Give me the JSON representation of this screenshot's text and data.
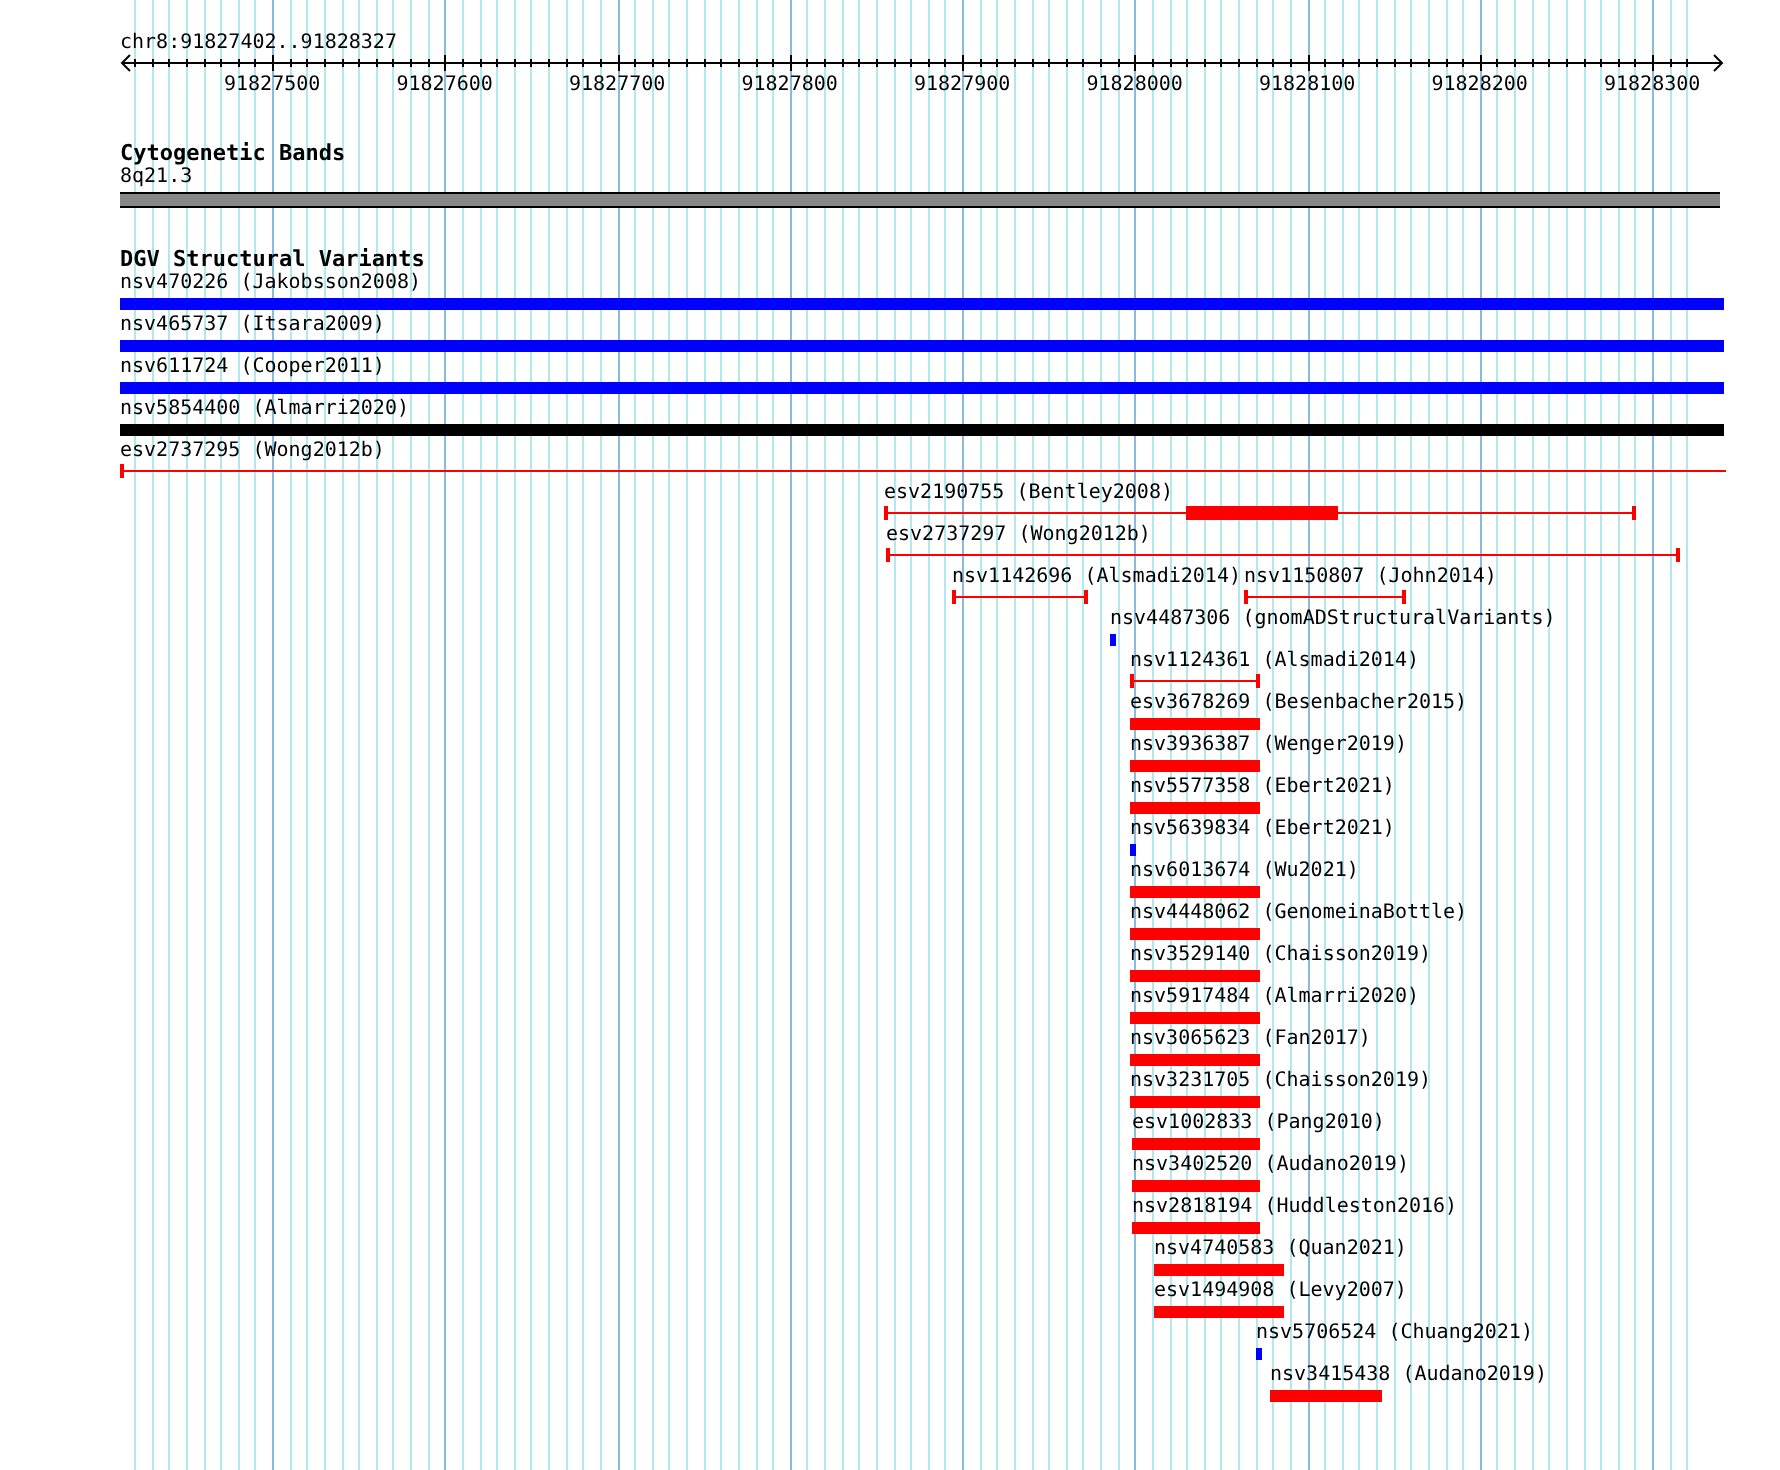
{
  "ruler": {
    "location": "chr8:91827402..91828327",
    "tick_labels": [
      "91827500",
      "91827600",
      "91827700",
      "91827800",
      "91827900",
      "91828000",
      "91828100",
      "91828200",
      "91828300"
    ]
  },
  "cytogenetic_bands": {
    "title": "Cytogenetic Bands",
    "band": "8q21.3"
  },
  "dgv_structural_variants": {
    "title": "DGV Structural Variants",
    "rows": [
      {
        "features": [
          {
            "label": "nsv470226 (Jakobsson2008)",
            "kind": "bar",
            "color": "#0000ff"
          }
        ]
      },
      {
        "features": [
          {
            "label": "nsv465737 (Itsara2009)",
            "kind": "bar",
            "color": "#0000ff"
          }
        ]
      },
      {
        "features": [
          {
            "label": "nsv611724 (Cooper2011)",
            "kind": "bar",
            "color": "#0000ff"
          }
        ]
      },
      {
        "features": [
          {
            "label": "nsv5854400 (Almarri2020)",
            "kind": "bar",
            "color": "#000000"
          }
        ]
      },
      {
        "features": [
          {
            "label": "esv2737295 (Wong2012b)",
            "kind": "range",
            "color": "#ff0000"
          }
        ]
      },
      {
        "features": [
          {
            "label": "esv2190755 (Bentley2008)",
            "kind": "range",
            "color": "#ff0000"
          }
        ]
      },
      {
        "features": [
          {
            "label": "esv2737297 (Wong2012b)",
            "kind": "range",
            "color": "#ff0000"
          }
        ]
      },
      {
        "features": [
          {
            "label": "nsv1142696 (Alsmadi2014)",
            "kind": "range",
            "color": "#ff0000"
          },
          {
            "label": "nsv1150807 (John2014)",
            "kind": "range",
            "color": "#ff0000"
          }
        ]
      },
      {
        "features": [
          {
            "label": "nsv4487306 (gnomADStructuralVariants)",
            "kind": "point",
            "color": "#0000ff"
          }
        ]
      },
      {
        "features": [
          {
            "label": "nsv1124361 (Alsmadi2014)",
            "kind": "range",
            "color": "#ff0000"
          }
        ]
      },
      {
        "features": [
          {
            "label": "esv3678269 (Besenbacher2015)",
            "kind": "bar",
            "color": "#ff0000"
          }
        ]
      },
      {
        "features": [
          {
            "label": "nsv3936387 (Wenger2019)",
            "kind": "bar",
            "color": "#ff0000"
          }
        ]
      },
      {
        "features": [
          {
            "label": "nsv5577358 (Ebert2021)",
            "kind": "bar",
            "color": "#ff0000"
          }
        ]
      },
      {
        "features": [
          {
            "label": "nsv5639834 (Ebert2021)",
            "kind": "point",
            "color": "#0000ff"
          }
        ]
      },
      {
        "features": [
          {
            "label": "nsv6013674 (Wu2021)",
            "kind": "bar",
            "color": "#ff0000"
          }
        ]
      },
      {
        "features": [
          {
            "label": "nsv4448062 (GenomeinaBottle)",
            "kind": "bar",
            "color": "#ff0000"
          }
        ]
      },
      {
        "features": [
          {
            "label": "nsv3529140 (Chaisson2019)",
            "kind": "bar",
            "color": "#ff0000"
          }
        ]
      },
      {
        "features": [
          {
            "label": "nsv5917484 (Almarri2020)",
            "kind": "bar",
            "color": "#ff0000"
          }
        ]
      },
      {
        "features": [
          {
            "label": "nsv3065623 (Fan2017)",
            "kind": "bar",
            "color": "#ff0000"
          }
        ]
      },
      {
        "features": [
          {
            "label": "nsv3231705 (Chaisson2019)",
            "kind": "bar",
            "color": "#ff0000"
          }
        ]
      },
      {
        "features": [
          {
            "label": "esv1002833 (Pang2010)",
            "kind": "bar",
            "color": "#ff0000"
          }
        ]
      },
      {
        "features": [
          {
            "label": "nsv3402520 (Audano2019)",
            "kind": "bar",
            "color": "#ff0000"
          }
        ]
      },
      {
        "features": [
          {
            "label": "nsv2818194 (Huddleston2016)",
            "kind": "bar",
            "color": "#ff0000"
          }
        ]
      },
      {
        "features": [
          {
            "label": "nsv4740583 (Quan2021)",
            "kind": "bar",
            "color": "#ff0000"
          }
        ]
      },
      {
        "features": [
          {
            "label": "esv1494908 (Levy2007)",
            "kind": "bar",
            "color": "#ff0000"
          }
        ]
      },
      {
        "features": [
          {
            "label": "nsv5706524 (Chuang2021)",
            "kind": "point",
            "color": "#0000ff"
          }
        ]
      },
      {
        "features": [
          {
            "label": "nsv3415438 (Audano2019)",
            "kind": "bar",
            "color": "#ff0000"
          }
        ]
      }
    ]
  }
}
